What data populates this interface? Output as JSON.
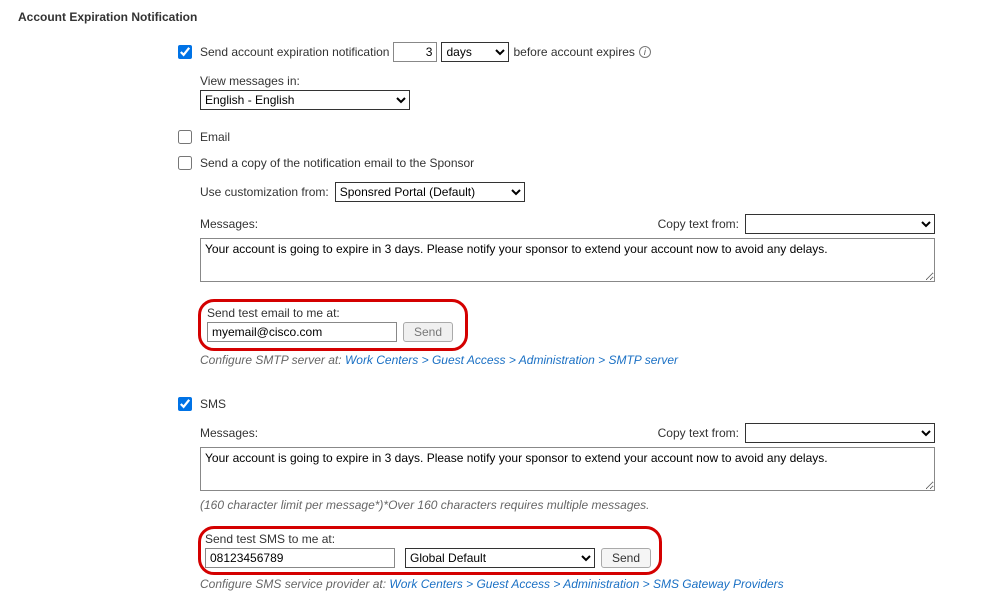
{
  "section_title": "Account Expiration Notification",
  "send_notification": {
    "checked": true,
    "label_before": "Send account expiration notification",
    "value": "3",
    "unit_options": [
      "days"
    ],
    "unit_selected": "days",
    "label_after": "before account expires"
  },
  "view_messages": {
    "label": "View messages in:",
    "options": [
      "English - English"
    ],
    "selected": "English - English"
  },
  "email": {
    "checked": false,
    "label": "Email"
  },
  "send_copy_sponsor": {
    "checked": false,
    "label": "Send a copy of the notification email to the Sponsor"
  },
  "customization": {
    "label": "Use customization from:",
    "options": [
      "Sponsred Portal (Default)"
    ],
    "selected": "Sponsred Portal (Default)"
  },
  "email_messages": {
    "label": "Messages:",
    "copy_label": "Copy text from:",
    "copy_options": [
      ""
    ],
    "textarea_value": "Your account is going to expire in 3 days. Please notify your sponsor to extend your account now to avoid any delays."
  },
  "email_test": {
    "label": "Send test email to me at:",
    "value": "myemail@cisco.com",
    "button": "Send"
  },
  "email_config_note": {
    "prefix": "Configure SMTP server at: ",
    "path": "Work Centers > Guest Access > Administration > SMTP server"
  },
  "sms": {
    "checked": true,
    "label": "SMS"
  },
  "sms_messages": {
    "label": "Messages:",
    "copy_label": "Copy text from:",
    "copy_options": [
      ""
    ],
    "textarea_value": "Your account is going to expire in 3 days. Please notify your sponsor to extend your account now to avoid any delays."
  },
  "sms_char_note": "(160 character limit per message*)*Over 160 characters requires multiple messages.",
  "sms_test": {
    "label": "Send test SMS to me at:",
    "value": "08123456789",
    "provider_options": [
      "Global Default"
    ],
    "provider_selected": "Global Default",
    "button": "Send"
  },
  "sms_config_note": {
    "prefix": "Configure SMS service provider at: ",
    "path": "Work Centers > Guest Access > Administration > SMS Gateway Providers"
  }
}
